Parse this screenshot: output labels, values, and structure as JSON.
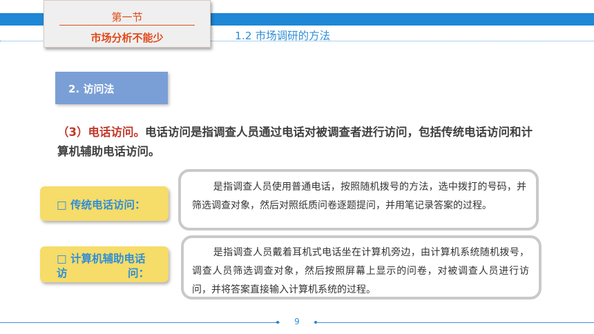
{
  "header": {
    "section_number": "第一节",
    "section_title": "市场分析不能少",
    "subtitle": "1.2  市场调研的方法"
  },
  "method": {
    "label": "2. 访问法"
  },
  "intro": {
    "lead": "（3）电话访问。",
    "body": "电话访问是指调查人员通过电话对被调查者进行访问，包括传统电话访问和计算机辅助电话访问。"
  },
  "items": [
    {
      "tag": "□ 传统电话访问：",
      "description": "是指调查人员使用普通电话，按照随机拨号的方法，选中拨打的号码，并筛选调查对象，然后对照纸质问卷逐题提问，并用笔记录答案的过程。"
    },
    {
      "tag_line1": "□ 计算机辅助电话",
      "tag_line2_left": "访",
      "tag_line2_right": "问：",
      "description": "是指调查人员戴着耳机式电话坐在计算机旁边，由计算机系统随机拨号，调查人员筛选调查对象，然后按照屏幕上显示的问卷，对被调查人员进行访问，并将答案直接输入计算机系统的过程。"
    }
  ],
  "footer": {
    "page_number": "9"
  },
  "colors": {
    "accent_blue": "#1e87d6",
    "accent_red": "#e04a1c",
    "tag_yellow": "#f6dc68",
    "method_blue": "#7a9fd6"
  }
}
